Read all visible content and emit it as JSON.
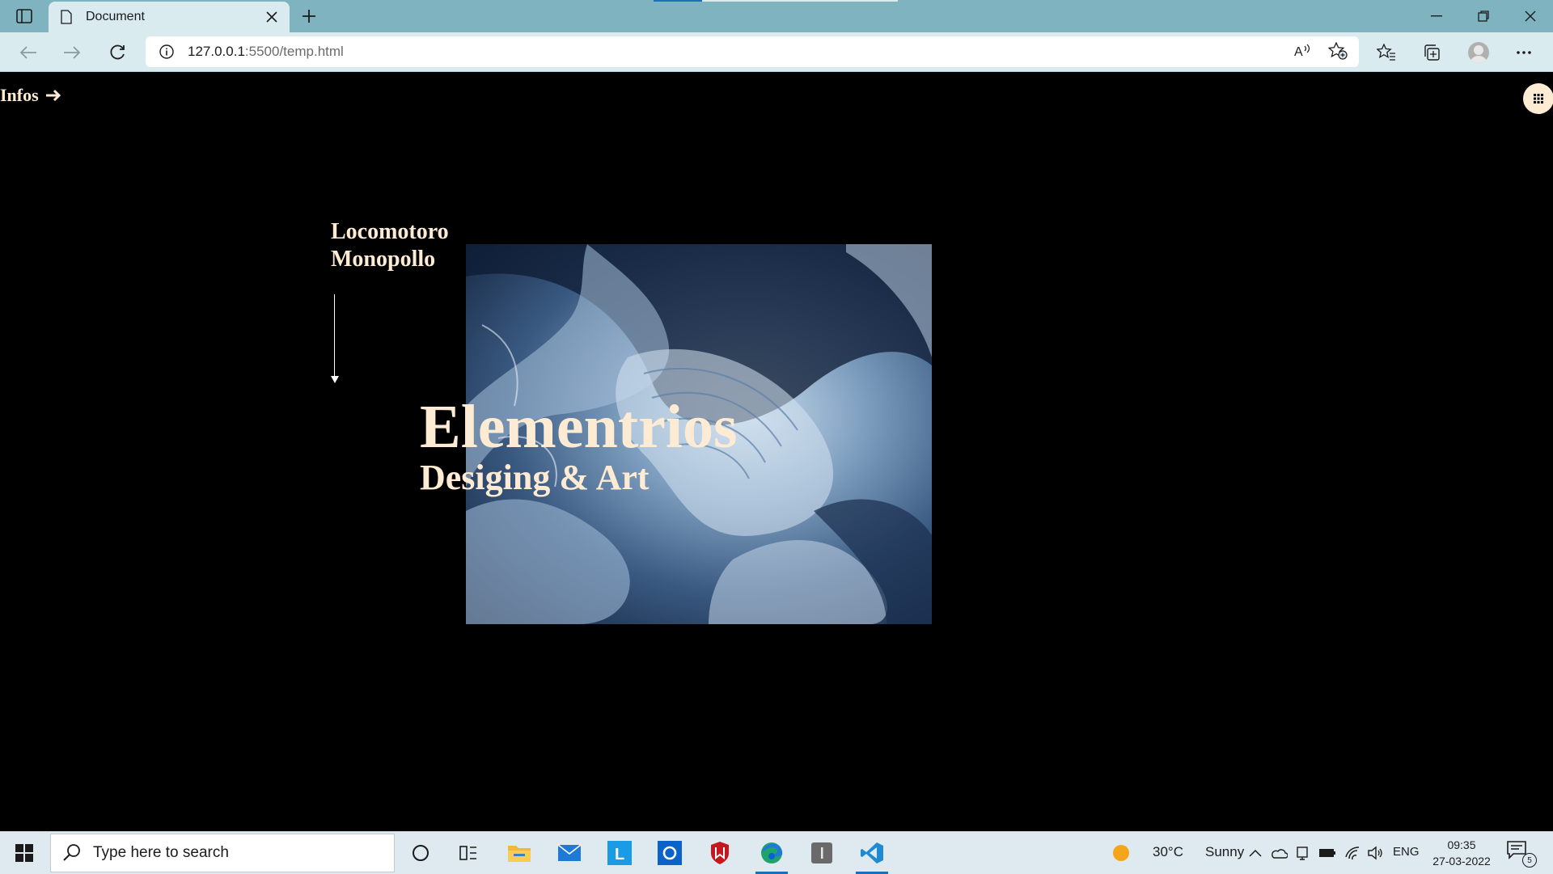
{
  "browser": {
    "tab_title": "Document",
    "url_host": "127.0.0.1",
    "url_rest": ":5500/temp.html",
    "load_progress": 0.2
  },
  "page": {
    "infos_label": "Infos",
    "brand_line1": "Locomotoro",
    "brand_line2": "Monopollo",
    "hero_title": "Elementrios",
    "hero_subtitle": "Desiging & Art",
    "accent_color": "#fdebd3"
  },
  "taskbar": {
    "search_placeholder": "Type here to search",
    "weather_temp": "30°C",
    "weather_desc": "Sunny",
    "language": "ENG",
    "time": "09:35",
    "date": "27-03-2022",
    "notification_count": "5"
  }
}
